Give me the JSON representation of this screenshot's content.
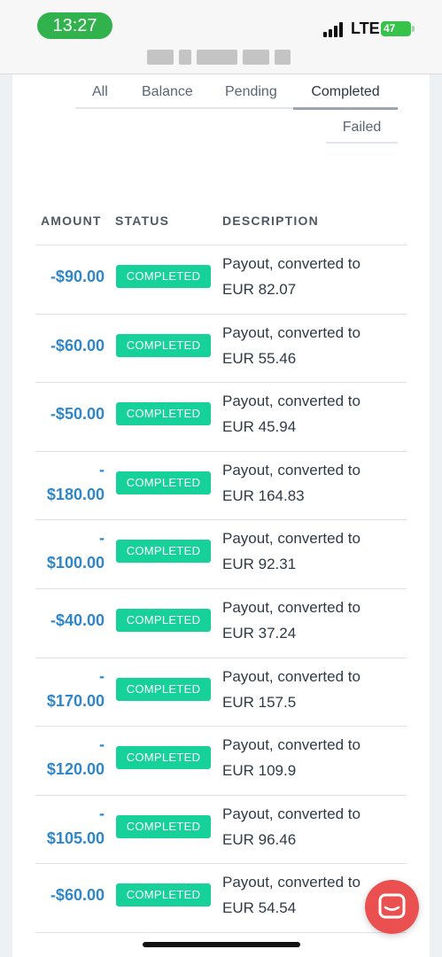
{
  "status_bar": {
    "time": "13:27",
    "network": "LTE",
    "battery": "47"
  },
  "tabs": {
    "all": "All",
    "balance": "Balance",
    "pending": "Pending",
    "completed": "Completed",
    "failed": "Failed",
    "active": "Completed"
  },
  "table": {
    "columns": {
      "amount": "AMOUNT",
      "status": "STATUS",
      "description": "DESCRIPTION"
    },
    "rows": [
      {
        "amount": "-$90.00",
        "status": "COMPLETED",
        "desc_line1": "Payout, converted to",
        "desc_line2": "EUR 82.07"
      },
      {
        "amount": "-$60.00",
        "status": "COMPLETED",
        "desc_line1": "Payout, converted to",
        "desc_line2": "EUR 55.46"
      },
      {
        "amount": "-$50.00",
        "status": "COMPLETED",
        "desc_line1": "Payout, converted to",
        "desc_line2": "EUR 45.94"
      },
      {
        "amount": "-\n$180.00",
        "status": "COMPLETED",
        "desc_line1": "Payout, converted to",
        "desc_line2": "EUR 164.83"
      },
      {
        "amount": "-\n$100.00",
        "status": "COMPLETED",
        "desc_line1": "Payout, converted to",
        "desc_line2": "EUR 92.31"
      },
      {
        "amount": "-$40.00",
        "status": "COMPLETED",
        "desc_line1": "Payout, converted to",
        "desc_line2": "EUR 37.24"
      },
      {
        "amount": "-\n$170.00",
        "status": "COMPLETED",
        "desc_line1": "Payout, converted to",
        "desc_line2": "EUR 157.5"
      },
      {
        "amount": "-\n$120.00",
        "status": "COMPLETED",
        "desc_line1": "Payout, converted to",
        "desc_line2": "EUR 109.9"
      },
      {
        "amount": "-\n$105.00",
        "status": "COMPLETED",
        "desc_line1": "Payout, converted to",
        "desc_line2": "EUR 96.46"
      },
      {
        "amount": "-$60.00",
        "status": "COMPLETED",
        "desc_line1": "Payout, converted to",
        "desc_line2": "EUR 54.54"
      }
    ]
  },
  "colors": {
    "amount": "#2f86c8",
    "status_badge": "#16d19a",
    "chat_button": "#ea5050",
    "time_pill": "#32b24c"
  },
  "icons": {
    "chat": "chat-bubble-icon",
    "signal": "cellular-signal-icon",
    "battery": "battery-icon"
  }
}
